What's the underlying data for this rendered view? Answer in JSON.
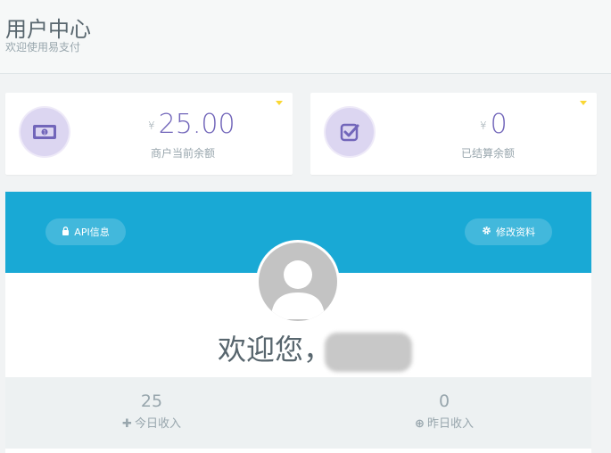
{
  "header": {
    "title": "用户中心",
    "subtitle": "欢迎使用易支付"
  },
  "cards": [
    {
      "icon": "money-icon",
      "currency": "¥",
      "value": "25.00",
      "label": "商户当前余额"
    },
    {
      "icon": "check-square-icon",
      "currency": "¥",
      "value": "0",
      "label": "已结算余额"
    }
  ],
  "profile": {
    "api_button": "API信息",
    "edit_button": "修改资料",
    "welcome": "欢迎您，"
  },
  "income": {
    "today_value": "25",
    "today_label": "今日收入",
    "yesterday_value": "0",
    "yesterday_label": "昨日收入"
  },
  "colors": {
    "banner": "#19a9d5",
    "accent": "#7266ba",
    "caret": "#fad733"
  }
}
